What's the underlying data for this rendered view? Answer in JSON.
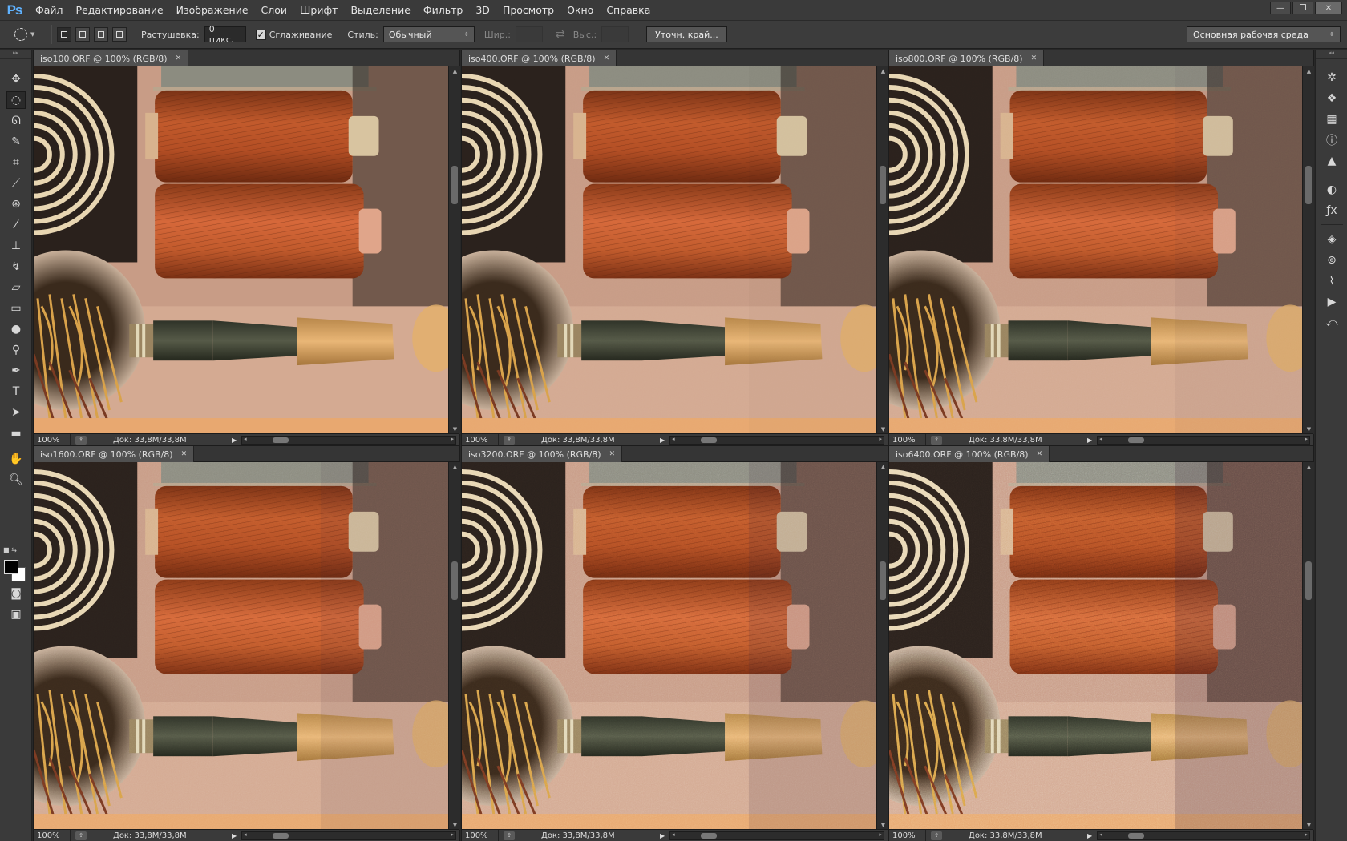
{
  "app": {
    "logo": "Ps",
    "menu": [
      "Файл",
      "Редактирование",
      "Изображение",
      "Слои",
      "Шрифт",
      "Выделение",
      "Фильтр",
      "3D",
      "Просмотр",
      "Окно",
      "Справка"
    ],
    "window_buttons": [
      "—",
      "❐",
      "✕"
    ]
  },
  "options": {
    "feather_label": "Растушевка:",
    "feather_value": "0 пикс.",
    "antialias_label": "Сглаживание",
    "antialias_checked": "✓",
    "style_label": "Стиль:",
    "style_value": "Обычный",
    "width_label": "Шир.:",
    "height_label": "Выс.:",
    "refine_button": "Уточн. край...",
    "workspace": "Основная рабочая среда"
  },
  "documents": [
    {
      "title": "iso100.ORF @ 100% (RGB/8)",
      "zoom": "100%",
      "doc_info": "Док: 33,8M/33,8M",
      "noise": 0.0
    },
    {
      "title": "iso400.ORF @ 100% (RGB/8)",
      "zoom": "100%",
      "doc_info": "Док: 33,8M/33,8M",
      "noise": 0.1
    },
    {
      "title": "iso800.ORF @ 100% (RGB/8)",
      "zoom": "100%",
      "doc_info": "Док: 33,8M/33,8M",
      "noise": 0.2
    },
    {
      "title": "iso1600.ORF @ 100% (RGB/8)",
      "zoom": "100%",
      "doc_info": "Док: 33,8M/33,8M",
      "noise": 0.35
    },
    {
      "title": "iso3200.ORF @ 100% (RGB/8)",
      "zoom": "100%",
      "doc_info": "Док: 33,8M/33,8M",
      "noise": 0.55
    },
    {
      "title": "iso6400.ORF @ 100% (RGB/8)",
      "zoom": "100%",
      "doc_info": "Док: 33,8M/33,8M",
      "noise": 0.8
    }
  ],
  "colors": {
    "fg": "#000000",
    "bg": "#ffffff",
    "ui_panel": "#3a3a3a",
    "logo": "#5fb2ff"
  },
  "tools_left": [
    "move-icon",
    "elliptical-marquee-icon",
    "lasso-icon",
    "quick-select-icon",
    "crop-icon",
    "eyedropper-icon",
    "spot-heal-icon",
    "brush-icon",
    "stamp-icon",
    "history-brush-icon",
    "eraser-icon",
    "gradient-icon",
    "blur-icon",
    "dodge-icon",
    "pen-icon",
    "type-icon",
    "path-select-icon",
    "rectangle-icon",
    "hand-icon",
    "zoom-icon",
    "quick-mask-icon",
    "screen-mode-icon"
  ],
  "tools_right": [
    "navigator-icon",
    "3d-icon",
    "swatches-icon",
    "info-icon",
    "histogram-icon",
    "adjustments-icon",
    "styles-icon",
    "layers-icon",
    "channels-icon",
    "paths-icon",
    "actions-icon",
    "history-icon"
  ]
}
